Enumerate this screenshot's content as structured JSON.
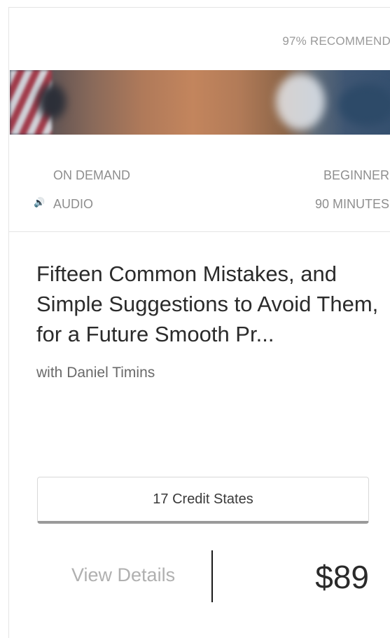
{
  "card": {
    "recommend": "97% RECOMMEND",
    "format": "ON DEMAND",
    "level": "BEGINNER",
    "media": "AUDIO",
    "duration": "90 MINUTES",
    "media_icon": "audio-icon",
    "title": "Fifteen Common Mistakes, and Simple Suggestions to Avoid Them, for a Future Smooth Pr...",
    "instructor_prefix": "with",
    "instructor_name": "Daniel Timins",
    "credit_button": "17 Credit States",
    "details_link": "View Details",
    "price": "$89"
  }
}
